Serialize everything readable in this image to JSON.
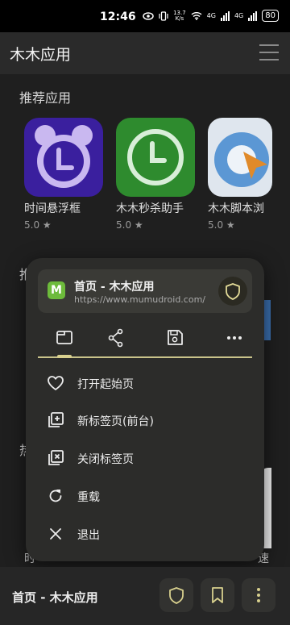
{
  "status_bar": {
    "time": "12:46",
    "net_speed_value": "13.7",
    "net_speed_unit": "K/s",
    "network1": "4G",
    "network2": "4G",
    "battery": "80"
  },
  "app_bar": {
    "title": "木木应用",
    "menu_icon": "hamburger-icon"
  },
  "sections": {
    "recommended_title": "推荐应用",
    "partial_title_2": "推",
    "partial_title_3": "热"
  },
  "recommended_apps": [
    {
      "name": "时间悬浮框",
      "rating": "5.0",
      "icon": "alarm-clock-icon",
      "color": "#3a1f9e"
    },
    {
      "name": "木木秒杀助手",
      "rating": "5.0",
      "icon": "clock-icon",
      "color": "#2e8b2e"
    },
    {
      "name": "木木脚本浏",
      "rating": "5.0",
      "icon": "cursor-icon",
      "color": "#5b97d4"
    }
  ],
  "background_peek": {
    "left_text": "时",
    "right_text": "速"
  },
  "menu": {
    "site_icon_letter": "M",
    "site_title": "首页 - 木木应用",
    "site_url": "https://www.mumudroid.com/",
    "toolbar": [
      {
        "icon": "tab-icon"
      },
      {
        "icon": "share-icon"
      },
      {
        "icon": "save-icon"
      },
      {
        "icon": "more-horizontal-icon"
      }
    ],
    "items": [
      {
        "label": "打开起始页",
        "icon": "heart-icon"
      },
      {
        "label": "新标签页(前台)",
        "icon": "new-tab-icon"
      },
      {
        "label": "关闭标签页",
        "icon": "close-tab-icon"
      },
      {
        "label": "重载",
        "icon": "reload-icon"
      },
      {
        "label": "退出",
        "icon": "close-icon"
      }
    ]
  },
  "bottom_bar": {
    "title": "首页 - 木木应用"
  },
  "colors": {
    "accent": "#d8d08e",
    "menu_bg": "#2c2c2a",
    "background": "#1f1f1f"
  }
}
